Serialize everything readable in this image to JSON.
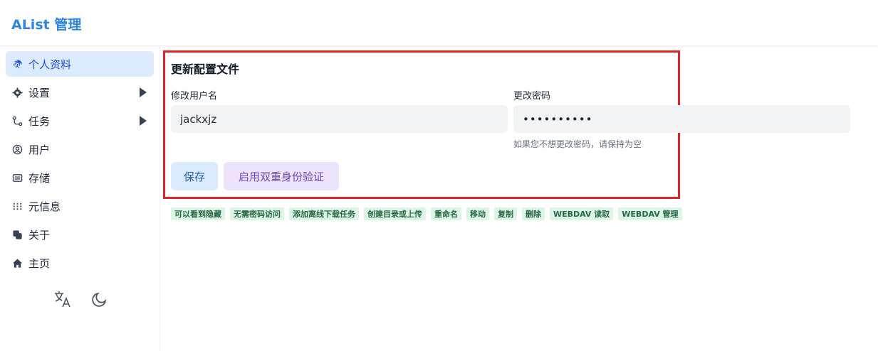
{
  "app": {
    "title": "AList 管理"
  },
  "sidebar": {
    "items": [
      {
        "label": "个人资料",
        "icon": "fingerprint-icon",
        "active": true
      },
      {
        "label": "设置",
        "icon": "gear-icon",
        "expandable": true
      },
      {
        "label": "任务",
        "icon": "route-icon",
        "expandable": true
      },
      {
        "label": "用户",
        "icon": "user-circle-icon"
      },
      {
        "label": "存储",
        "icon": "storage-icon"
      },
      {
        "label": "元信息",
        "icon": "meta-grid-icon"
      },
      {
        "label": "关于",
        "icon": "copy-squares-icon"
      },
      {
        "label": "主页",
        "icon": "home-icon"
      }
    ],
    "tools": {
      "language_icon": "translate-icon",
      "theme_icon": "moon-icon"
    }
  },
  "form": {
    "title": "更新配置文件",
    "username_label": "修改用户名",
    "username_value": "jackxjz",
    "password_label": "更改密码",
    "password_value": "••••••••••",
    "password_hint": "如果您不想更改密码，请保持为空",
    "save_label": "保存",
    "twofa_label": "启用双重身份验证"
  },
  "permissions": [
    "可以看到隐藏",
    "无需密码访问",
    "添加离线下载任务",
    "创建目录或上传",
    "重命名",
    "移动",
    "复制",
    "删除",
    "WEBDAV 读取",
    "WEBDAV 管理"
  ],
  "colors": {
    "accent": "#2e86de",
    "active_bg": "#dbeafe",
    "highlight_border": "#e02424",
    "badge_bg": "#dcf5e4",
    "badge_text": "#276749"
  }
}
